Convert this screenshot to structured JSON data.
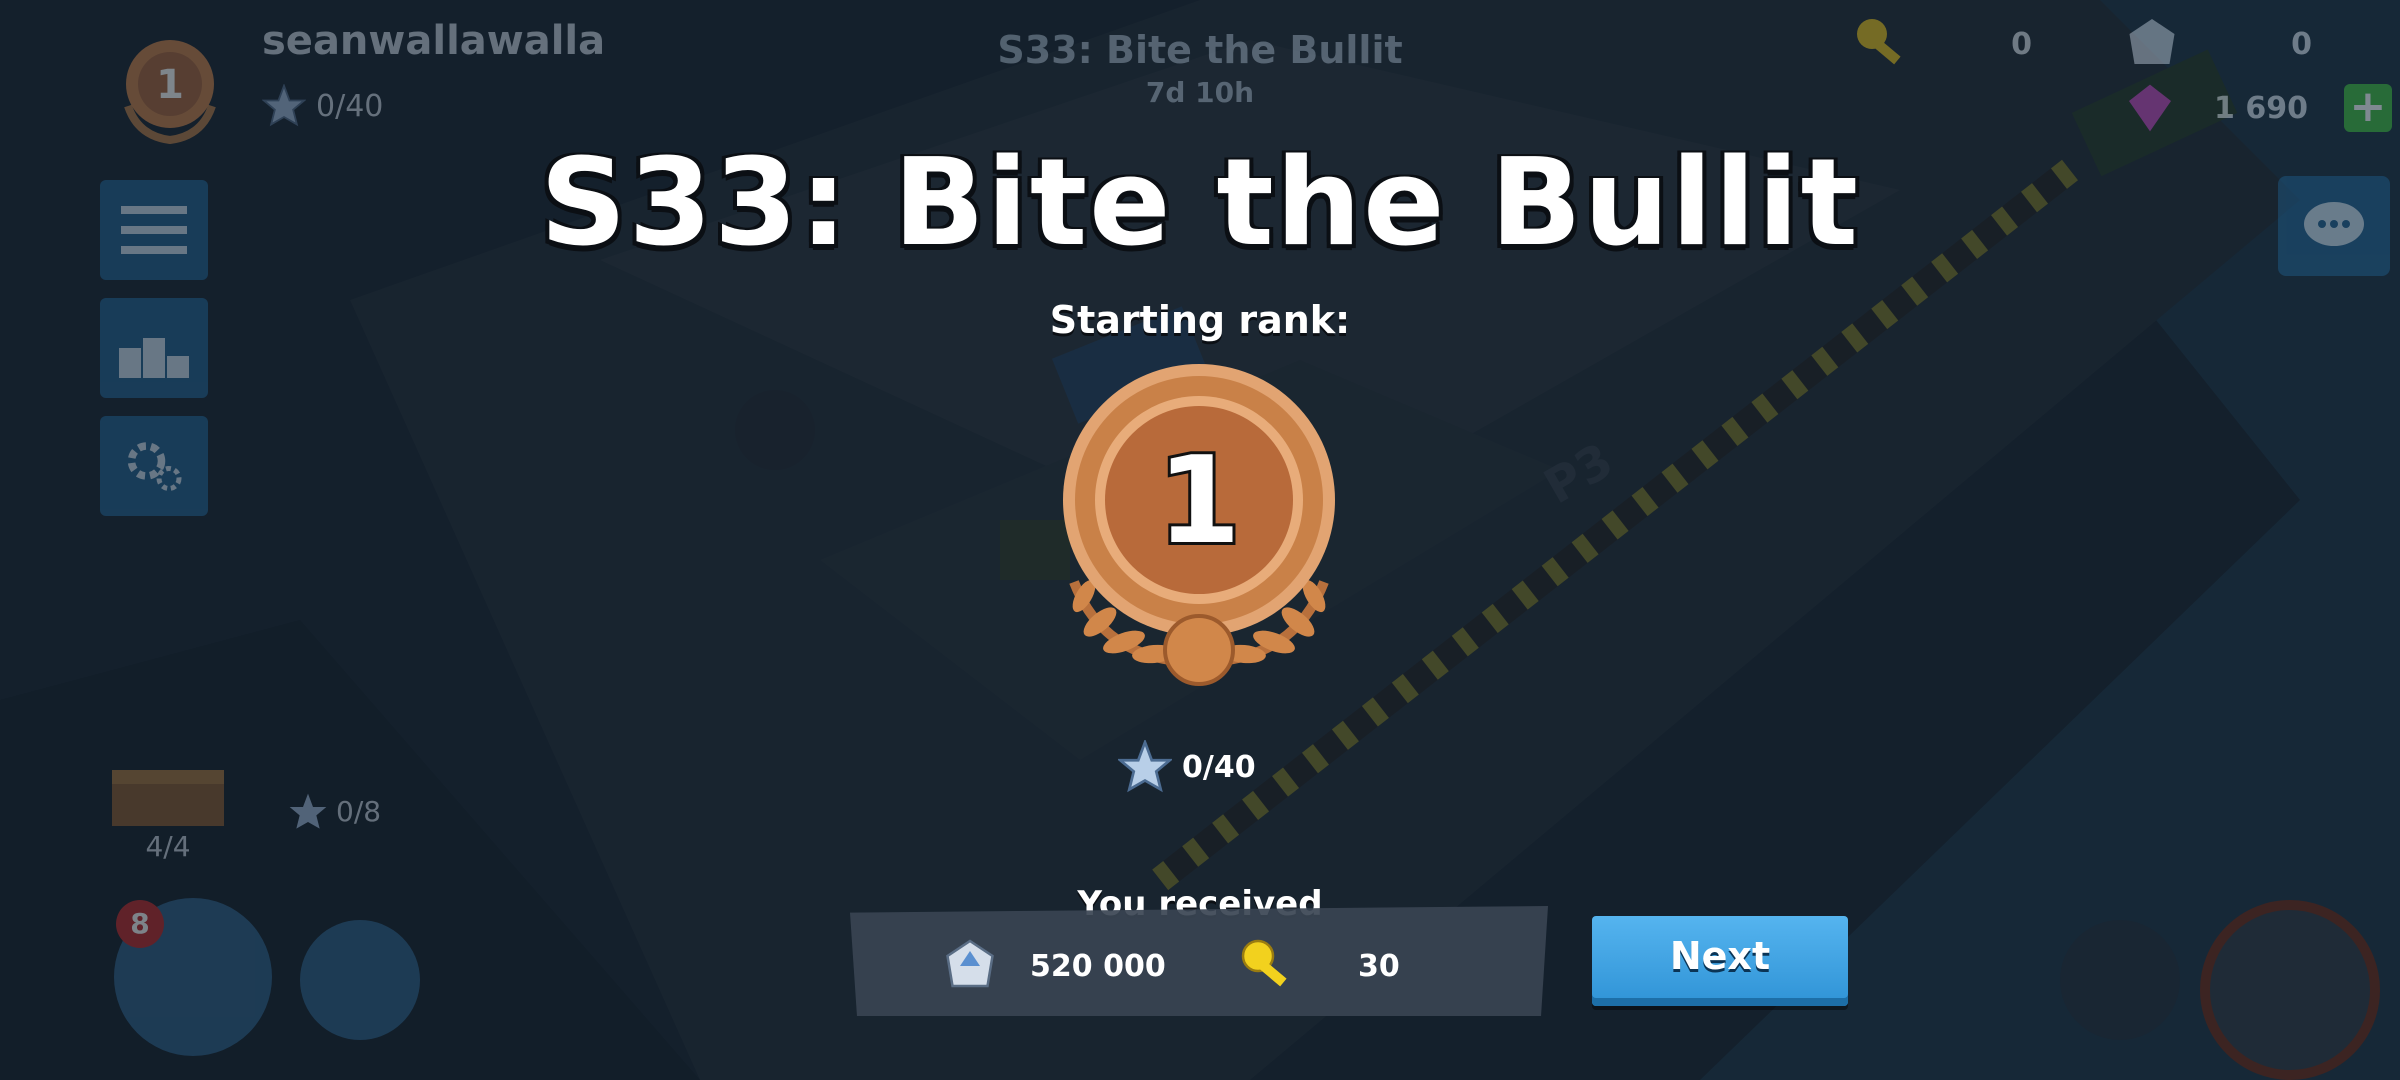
{
  "player": {
    "name": "seanwallawalla",
    "rank": "1",
    "stars": "0/40"
  },
  "season_header": {
    "title": "S33: Bite the Bullit",
    "timer": "7d 10h"
  },
  "resources": {
    "keys": "0",
    "gold": "0",
    "gems": "1 690"
  },
  "hq_progress": {
    "chest_count": "4/4",
    "parts": "0/8",
    "badge_count": "8"
  },
  "overlay": {
    "title": "S33: Bite the Bullit",
    "rank_label": "Starting rank:",
    "rank_number": "1",
    "stars": "0/40",
    "received_label": "You received",
    "rewards": {
      "gold": "520 000",
      "keys": "30"
    },
    "next_button": "Next"
  },
  "colors": {
    "bronze": "#c98148",
    "next_button": "#3fa2e2",
    "panel": "#3a4452"
  },
  "icons": [
    "menu-icon",
    "leaderboard-icon",
    "gear-icon",
    "chat-icon",
    "star-icon",
    "key-icon",
    "gold-icon",
    "gem-icon",
    "plus-icon",
    "chest-icon",
    "laurel-icon"
  ]
}
